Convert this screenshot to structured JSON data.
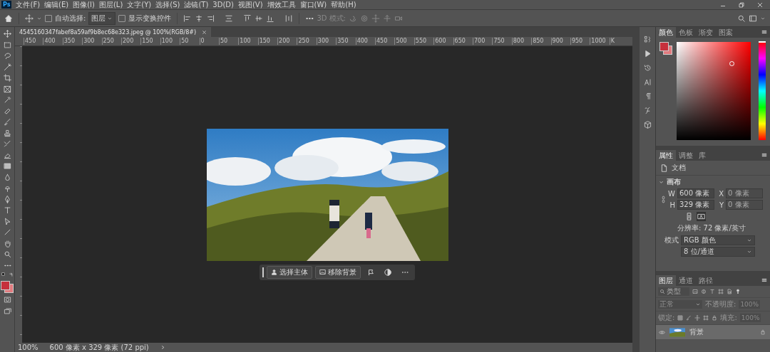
{
  "app": {
    "logo": "Ps"
  },
  "menu": [
    "文件(F)",
    "编辑(E)",
    "图像(I)",
    "图层(L)",
    "文字(Y)",
    "选择(S)",
    "滤镜(T)",
    "3D(D)",
    "视图(V)",
    "增效工具",
    "窗口(W)",
    "帮助(H)"
  ],
  "options_bar": {
    "auto_select": {
      "label": "自动选择:",
      "checked": false
    },
    "target": "图层",
    "show_transform": {
      "label": "显示变换控件",
      "checked": false
    },
    "mode_3d": {
      "label": "3D 模式:",
      "disabled": true
    }
  },
  "document": {
    "tab": {
      "title": "4545160347fabef8a59af9b8ec68e323.jpeg @ 100%(RGB/8#)",
      "selected": true
    }
  },
  "ruler": [
    "450",
    "400",
    "350",
    "300",
    "250",
    "200",
    "150",
    "100",
    "50",
    "0",
    "50",
    "100",
    "150",
    "200",
    "250",
    "300",
    "350",
    "400",
    "450",
    "500",
    "550",
    "600",
    "650",
    "700",
    "750",
    "800",
    "850",
    "900",
    "950",
    "1000",
    "K"
  ],
  "context_bar": {
    "buttons": [
      "选择主体",
      "移除背景"
    ]
  },
  "status_bar": {
    "zoom": "100%",
    "info": "600 像素 x 329 像素 (72 ppi)"
  },
  "color_panel": {
    "hue": {
      "level": 1
    },
    "tabs": [
      {
        "label": "颜色",
        "selected": true
      },
      {
        "label": "色板",
        "selected": false
      },
      {
        "label": "渐变",
        "selected": false
      },
      {
        "label": "图案",
        "selected": false
      }
    ]
  },
  "properties_panel": {
    "tabs": [
      {
        "label": "属性",
        "selected": true
      },
      {
        "label": "调整",
        "selected": false
      },
      {
        "label": "库",
        "selected": false
      }
    ],
    "document_label": "文档",
    "canvas": {
      "title": "画布",
      "expanded": true,
      "w_label": "W",
      "w": "600 像素",
      "x_label": "X",
      "x_placeholder": "0 像素",
      "h_label": "H",
      "h": "329 像素",
      "y_label": "Y",
      "y_placeholder": "0 像素",
      "orientations": [
        {
          "kind": "portrait",
          "selected": false
        },
        {
          "kind": "landscape",
          "selected": true
        }
      ],
      "resolution": "分辨率: 72 像素/英寸",
      "mode_label": "模式",
      "mode": "RGB 颜色",
      "depth": "8 位/通道"
    }
  },
  "layers_panel": {
    "tabs": [
      {
        "label": "图层",
        "selected": true
      },
      {
        "label": "通道",
        "selected": false
      },
      {
        "label": "路径",
        "selected": false
      }
    ],
    "filter_placeholder": "类型",
    "blend_mode": "正常",
    "opacity_label": "不透明度:",
    "opacity": "100%",
    "lock_label": "锁定:",
    "fill_label": "填充:",
    "fill": "100%",
    "layers": [
      {
        "name": "背景",
        "visible": true,
        "locked": true,
        "selected": true
      }
    ]
  }
}
